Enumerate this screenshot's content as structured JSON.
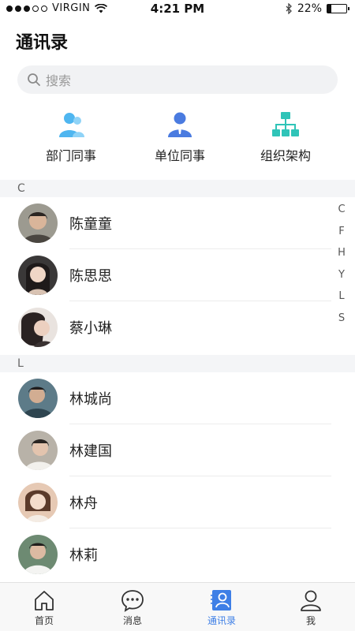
{
  "status_bar": {
    "carrier": "VIRGIN",
    "time": "4:21 PM",
    "battery": "22%",
    "battery_level": 0.22,
    "signal_bars_filled": 3,
    "signal_bars_total": 5
  },
  "page": {
    "title": "通讯录"
  },
  "search": {
    "placeholder": "搜索"
  },
  "shortcuts": [
    {
      "label": "部门同事",
      "icon": "department-colleagues-icon",
      "color": "#4fb6f0"
    },
    {
      "label": "单位同事",
      "icon": "unit-colleagues-icon",
      "color": "#4a7be0"
    },
    {
      "label": "组织架构",
      "icon": "org-structure-icon",
      "color": "#2fc4b8"
    }
  ],
  "sections": [
    {
      "letter": "C",
      "contacts": [
        {
          "name": "陈童童"
        },
        {
          "name": "陈思思"
        },
        {
          "name": "蔡小琳"
        }
      ]
    },
    {
      "letter": "L",
      "contacts": [
        {
          "name": "林城尚"
        },
        {
          "name": "林建国"
        },
        {
          "name": "林舟"
        },
        {
          "name": "林莉"
        }
      ]
    }
  ],
  "index_letters": [
    "C",
    "F",
    "H",
    "Y",
    "L",
    "S"
  ],
  "tabs": [
    {
      "label": "首页",
      "icon": "home-icon",
      "active": false
    },
    {
      "label": "消息",
      "icon": "message-icon",
      "active": false
    },
    {
      "label": "通讯录",
      "icon": "contacts-icon",
      "active": true
    },
    {
      "label": "我",
      "icon": "profile-icon",
      "active": false
    }
  ],
  "colors": {
    "accent": "#3e7fe6",
    "section_bg": "#f4f5f7"
  }
}
